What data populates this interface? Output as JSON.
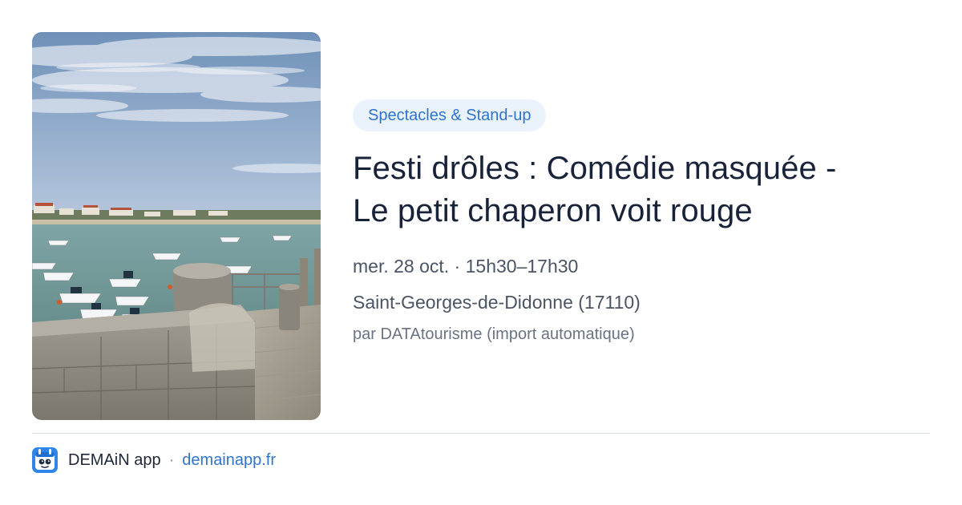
{
  "event": {
    "category": "Spectacles & Stand-up",
    "title_line1": "Festi drôles : Comédie masquée -",
    "title_line2": "Le petit chaperon voit rouge",
    "date": "mer. 28 oct. · 15h30–17h30",
    "place": "Saint-Georges-de-Didonne (17110)",
    "source": "par DATAtourisme (import automatique)"
  },
  "footer": {
    "app_name": "DEMAiN app",
    "separator": "·",
    "url": "demainapp.fr"
  },
  "icons": {
    "logo": "demain-app-logo-icon"
  },
  "colors": {
    "accent": "#2f74cf",
    "chip_bg": "#eaf2fc",
    "title": "#18233a"
  }
}
